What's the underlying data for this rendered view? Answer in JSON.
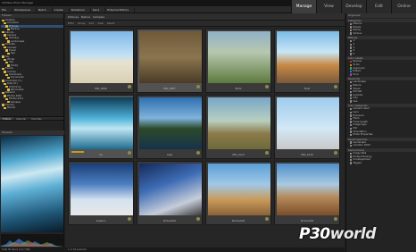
{
  "app": {
    "title": "ACDSee Photo Manager",
    "modes": [
      "Manage",
      "View",
      "Develop",
      "Edit",
      "Online"
    ],
    "active_mode": "Manage"
  },
  "menubar": {
    "items": [
      "File",
      "Workspaces",
      "Batch",
      "Create",
      "Slideshow",
      "Send",
      "External Editors"
    ]
  },
  "left_panel": {
    "folders_title": "Folders",
    "folders": [
      "Desktop",
      "Computer",
      "Pictures",
      "Backup",
      "Albums",
      "Camera",
      "Holidays",
      "Landscapes",
      "Portraits",
      "Animals",
      "Travel",
      "Sea",
      "Sky",
      "Winter",
      "City",
      "Family",
      "Events",
      "Archive",
      "Downloads",
      "Documents",
      "Local Disk (C:)",
      "Data (D:)",
      "DVD Drive",
      "Removable",
      "Network",
      "Photos 2010",
      "Photos 2011",
      "Samples",
      "Exports",
      "Shared"
    ],
    "selected_folder_index": 2,
    "tabs": [
      "Folders",
      "Calendar",
      "Favorites"
    ],
    "active_tab": "Folders",
    "preview_title": "Preview",
    "status": "Total 36 items (19.7 MB)"
  },
  "center": {
    "address": [
      "Pictures",
      "Nature",
      "Samples"
    ],
    "filter": [
      "Filter",
      "Group",
      "Sort",
      "View",
      "Select"
    ],
    "thumbnails": [
      {
        "caption": "IMG_0066",
        "selected": false,
        "rated": false
      },
      {
        "caption": "IMG_0067",
        "selected": true,
        "rated": false
      },
      {
        "caption": "Birds",
        "selected": false,
        "rated": false
      },
      {
        "caption": "Boat",
        "selected": false,
        "rated": false
      },
      {
        "caption": "Ice",
        "selected": true,
        "rated": true
      },
      {
        "caption": "Lake",
        "selected": false,
        "rated": false
      },
      {
        "caption": "IMG_1024",
        "selected": false,
        "rated": false
      },
      {
        "caption": "IMG_1030",
        "selected": false,
        "rated": false
      },
      {
        "caption": "Aviation",
        "selected": false,
        "rated": false
      },
      {
        "caption": "Picture001",
        "selected": false,
        "rated": false
      },
      {
        "caption": "Picture003",
        "selected": false,
        "rated": false
      },
      {
        "caption": "Picture004",
        "selected": false,
        "rated": false
      }
    ],
    "status": "1 of 36 selected"
  },
  "right_panel": {
    "title": "Organize",
    "sections": [
      {
        "name": "Categories",
        "items": [
          "Albums",
          "People",
          "Places",
          "Various"
        ]
      },
      {
        "name": "Ratings",
        "items": [
          "1",
          "2",
          "3",
          "4",
          "5"
        ]
      },
      {
        "name": "Color Labels",
        "items": [
          "Review",
          "To Do",
          "Approved",
          "Edited",
          "Final"
        ]
      },
      {
        "name": "Keywords",
        "items": [
          "Landscape",
          "Nature",
          "Travel",
          "Portrait",
          "Animals",
          "City",
          "Sea"
        ]
      },
      {
        "name": "Auto Categories",
        "items": [
          "Camera Used",
          "Lens",
          "Exposure",
          "Flash",
          "Focal length",
          "Image type",
          "ISO",
          "Orientation",
          "Photo Properties"
        ]
      },
      {
        "name": "Saved Searches",
        "items": [
          "Landscape",
          "vacation 2009"
        ]
      },
      {
        "name": "Special Items",
        "items": [
          "Image Well",
          "Embed Pending",
          "Uncategorized",
          "Tagged"
        ]
      }
    ],
    "label_colors": [
      "#c0392b",
      "#e67e22",
      "#27ae60",
      "#2980b9",
      "#8e44ad"
    ]
  },
  "watermark": {
    "text_a": "P30",
    "text_b": "world"
  }
}
